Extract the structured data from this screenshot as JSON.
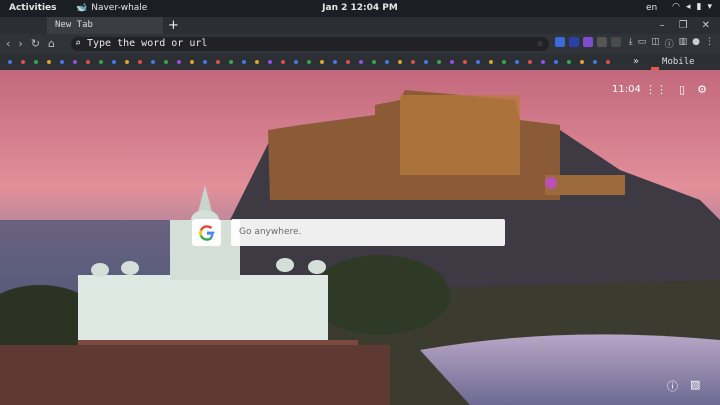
{
  "system_bar": {
    "activities": "Activities",
    "app_name": "Naver-whale",
    "clock": "Jan 2  12:04 PM",
    "lang": "en"
  },
  "tabs": [
    {
      "label": "New Tab"
    }
  ],
  "new_tab_glyph": "+",
  "toolbar": {
    "address_placeholder": "Type the word or url"
  },
  "bookmarks": {
    "more_glyph": "»",
    "folder_label": "Mobile bo..."
  },
  "new_tab_page": {
    "time": "11:04",
    "search_placeholder": "Go anywhere."
  },
  "colors": {
    "system_bar": "#1b1e23",
    "tab_bg": "#3a3d42",
    "toolbar_bg": "#303338",
    "sky_top": "#b65a78",
    "sky_mid": "#f0a0a8"
  }
}
